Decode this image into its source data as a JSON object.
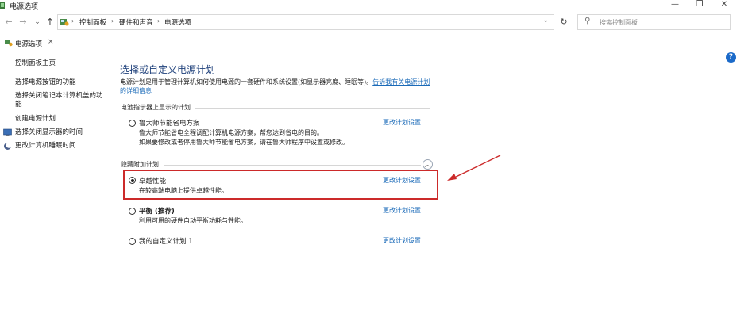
{
  "window": {
    "title": "电源选项",
    "minimize": "—",
    "maximize": "❐",
    "close": "✕"
  },
  "nav": {
    "back": "←",
    "forward": "→",
    "recent": "⌄",
    "up": "↑",
    "breadcrumbs": [
      "控制面板",
      "硬件和声音",
      "电源选项"
    ],
    "separator": "›",
    "dropdown": "⌄",
    "refresh": "↻",
    "search_placeholder": "搜索控制面板",
    "search_icon": "⚲"
  },
  "tab": {
    "label": "电源选项",
    "close": "×"
  },
  "help": "?",
  "sidebar": {
    "items": [
      {
        "label": "控制面板主页",
        "icon": null
      },
      {
        "label": "选择电源按钮的功能",
        "icon": null
      },
      {
        "label": "选择关闭笔记本计算机盖的功能",
        "icon": null
      },
      {
        "label": "创建电源计划",
        "icon": null
      },
      {
        "label": "选择关闭显示器的时间",
        "icon": "monitor-icon"
      },
      {
        "label": "更改计算机睡眠时间",
        "icon": "moon-icon"
      }
    ]
  },
  "main": {
    "heading": "选择或自定义电源计划",
    "description": "电源计划是用于管理计算机如何使用电源的一套硬件和系统设置(如显示器亮度、睡眠等)。",
    "description_link": "告诉我有关电源计划的详细信息",
    "section1_label": "电池指示器上显示的计划",
    "section2_label": "隐藏附加计划",
    "collapse_icon": "︿",
    "plans": [
      {
        "name": "鲁大师节能省电方案",
        "desc_lines": [
          "鲁大师节能省电全程调配计算机电源方案，帮您达到省电的目的。",
          "如果要修改或者停用鲁大师节能省电方案，请在鲁大师程序中设置或修改。"
        ],
        "link": "更改计划设置",
        "selected": false,
        "bold": false
      },
      {
        "name": "卓越性能",
        "desc_lines": [
          "在较高端电脑上提供卓越性能。"
        ],
        "link": "更改计划设置",
        "selected": true,
        "bold": false
      },
      {
        "name": "平衡 (推荐)",
        "desc_lines": [
          "利用可用的硬件自动平衡功耗与性能。"
        ],
        "link": "更改计划设置",
        "selected": false,
        "bold": true
      },
      {
        "name": "我的自定义计划 1",
        "desc_lines": [],
        "link": "更改计划设置",
        "selected": false,
        "bold": false
      }
    ]
  },
  "colors": {
    "heading": "#1d3f7a",
    "link": "#1a6ab8",
    "highlight": "#cc2a2a",
    "help": "#1b6ac9"
  }
}
